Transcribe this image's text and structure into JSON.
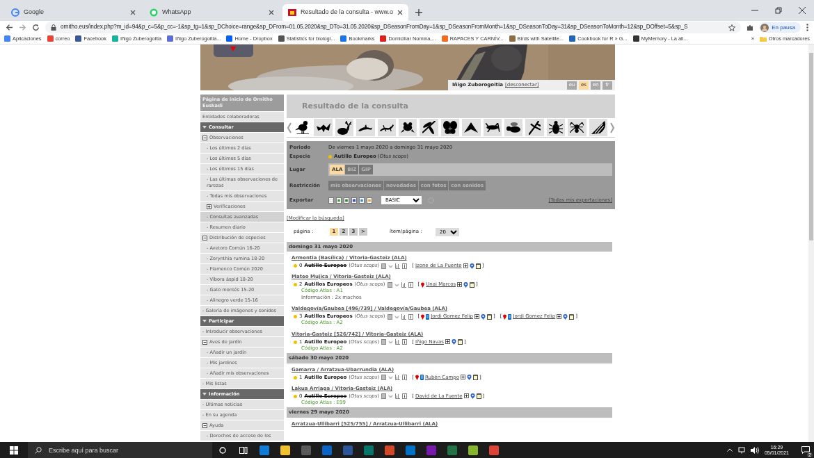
{
  "browser": {
    "tabs": [
      {
        "title": "Google",
        "selected": false,
        "kind": "google"
      },
      {
        "title": "WhatsApp",
        "selected": false,
        "kind": "whatsapp"
      },
      {
        "title": "Resultado de la consulta - www.o",
        "selected": true,
        "kind": "site"
      }
    ],
    "url": "ornitho.eus/index.php?m_id=94&p_c=5&p_cc=-1&sp_tg=1&sp_DChoice=range&sp_DFrom=01.05.2020&sp_DTo=31.05.2020&sp_DSeasonFromDay=1&sp_DSeasonFromMonth=1&sp_DSeasonToDay=31&sp_DSeasonToMonth=12&sp_DOffset=5&sp_S",
    "profile": "En pausa",
    "bookmarks": [
      {
        "label": "Aplicaciones",
        "color": "#4285f4"
      },
      {
        "label": "correo",
        "color": "#ea4335"
      },
      {
        "label": "Facebook",
        "color": "#3b5998"
      },
      {
        "label": "Iñigo Zuberogoitia",
        "color": "#18b39b"
      },
      {
        "label": "Iñigo Zuberogoitia...",
        "color": "#5b6fd6"
      },
      {
        "label": "Home - Dropbox",
        "color": "#0061fe"
      },
      {
        "label": "Statistics for biologi...",
        "color": "#555555"
      },
      {
        "label": "Bookmarks",
        "color": "#1a73e8"
      },
      {
        "label": "Domiciliar Nomina,...",
        "color": "#e0201b"
      },
      {
        "label": "RAPACES Y CARNÍV...",
        "color": "#f36d21"
      },
      {
        "label": "Birds with Satellite...",
        "color": "#8d6e48"
      },
      {
        "label": "Cookbook for R » G...",
        "color": "#2165b6"
      },
      {
        "label": "MyMemory - La ali...",
        "color": "#333333"
      }
    ],
    "bookmarks_overflow": "»",
    "other_bookmarks": "Otros marcadores"
  },
  "header": {
    "user": "Iñigo Zuberogoitia",
    "logout": "[desconectar]",
    "languages": [
      {
        "code": "eu",
        "selected": false
      },
      {
        "code": "es",
        "selected": true
      },
      {
        "code": "en",
        "selected": false
      },
      {
        "code": "fr",
        "selected": false
      }
    ]
  },
  "sidebar": [
    {
      "kind": "home",
      "text": "Página de inicio de Ornitho Euskadi",
      "selected": false
    },
    {
      "kind": "link",
      "text": "Entidades colaboradoras",
      "selected": false
    },
    {
      "kind": "header",
      "text": "Consultar",
      "expanded": true,
      "children": [
        {
          "kind": "group",
          "text": "Observaciones",
          "expanded": true,
          "children": [
            {
              "kind": "link",
              "text": "- Los últimos 2 días",
              "selected": false
            },
            {
              "kind": "link",
              "text": "- Los últimos 5 días",
              "selected": false
            },
            {
              "kind": "link",
              "text": "- Los últimos 15 días",
              "selected": false
            },
            {
              "kind": "link",
              "text": "- Las últimas observaciones de rarezas",
              "selected": false
            },
            {
              "kind": "link",
              "text": "- Todas mis observaciones",
              "selected": false
            },
            {
              "kind": "group",
              "text": "Verificaciones",
              "expanded": false
            },
            {
              "kind": "link",
              "text": "- Consultas avanzadas",
              "selected": true
            },
            {
              "kind": "link",
              "text": "- Resumen diario",
              "selected": false
            }
          ]
        },
        {
          "kind": "group",
          "text": "Distribución de especies",
          "expanded": true,
          "children": [
            {
              "kind": "link",
              "text": "- Avetoro Común 16-20",
              "selected": false
            },
            {
              "kind": "link",
              "text": "- Zerynthia rumina 18-20",
              "selected": false
            },
            {
              "kind": "link",
              "text": "- Flamenco Común 2020",
              "selected": false
            },
            {
              "kind": "link",
              "text": "- Víbora áspid 18-20",
              "selected": false
            },
            {
              "kind": "link",
              "text": "- Gato montés 15-20",
              "selected": false
            },
            {
              "kind": "link",
              "text": "- Alinegro verde 15-16",
              "selected": false
            }
          ]
        },
        {
          "kind": "link",
          "text": "- Galería de imágenes y sonidos",
          "selected": false
        }
      ]
    },
    {
      "kind": "header",
      "text": "Participar",
      "expanded": true,
      "children": [
        {
          "kind": "link",
          "text": "- Introducir observaciones",
          "selected": false
        },
        {
          "kind": "group",
          "text": "Aves de jardín",
          "expanded": true,
          "children": [
            {
              "kind": "link",
              "text": "- Añadir un jardín",
              "selected": false
            },
            {
              "kind": "link",
              "text": "- Mis jardines",
              "selected": false
            },
            {
              "kind": "link",
              "text": "- Añadir mis observaciones",
              "selected": false
            }
          ]
        },
        {
          "kind": "link",
          "text": "- Mis listas",
          "selected": false
        }
      ]
    },
    {
      "kind": "header",
      "text": "Información",
      "expanded": true,
      "children": [
        {
          "kind": "link",
          "text": "- Últimas noticias",
          "selected": false
        },
        {
          "kind": "link",
          "text": "- En su agenda",
          "selected": false
        },
        {
          "kind": "group",
          "text": "Ayuda",
          "expanded": true,
          "children": [
            {
              "kind": "link",
              "text": "- Derechos de acceso de los",
              "selected": false
            }
          ]
        }
      ]
    }
  ],
  "title": "Resultado de la consulta",
  "taxa": [
    {
      "kind": "bird",
      "selected": true
    },
    {
      "kind": "bat",
      "selected": false
    },
    {
      "kind": "deer",
      "selected": false
    },
    {
      "kind": "dolphin",
      "selected": false
    },
    {
      "kind": "lizard",
      "selected": false
    },
    {
      "kind": "frog",
      "selected": false
    },
    {
      "kind": "dragonfly",
      "selected": false
    },
    {
      "kind": "butterfly",
      "selected": false
    },
    {
      "kind": "moth",
      "selected": false
    },
    {
      "kind": "grasshopper",
      "selected": false
    },
    {
      "kind": "bee",
      "selected": false
    },
    {
      "kind": "mantis",
      "selected": false
    },
    {
      "kind": "beetle",
      "selected": false
    },
    {
      "kind": "spider",
      "selected": false
    },
    {
      "kind": "shell",
      "selected": false
    }
  ],
  "filters": {
    "period_label": "Periodo",
    "period": "De viernes 1 mayo 2020 a domingo 31 mayo 2020",
    "species_label": "Especie",
    "species": "**Autillo Europeo** (*Otus scops*)",
    "place_label": "Lugar",
    "places": [
      {
        "label": "ALA",
        "selected": true
      },
      {
        "label": "BIZ",
        "selected": false
      },
      {
        "label": "GIP",
        "selected": false
      }
    ],
    "restriction_label": "Restricción",
    "restrictions": [
      {
        "label": "mis observaciones",
        "selected": false
      },
      {
        "label": "novedades",
        "selected": false
      },
      {
        "label": "con fotos",
        "selected": false
      },
      {
        "label": "con sonidos",
        "selected": false
      }
    ],
    "export_label": "Exportar",
    "export_format": "BASIC",
    "all_exports": "[Todas mis exportaciones]"
  },
  "modify": "[Modificar la búsqueda]",
  "pager": {
    "label": "página :",
    "pages": [
      {
        "label": "1",
        "selected": true
      },
      {
        "label": "2",
        "selected": false
      },
      {
        "label": "3",
        "selected": false
      },
      {
        "label": ">",
        "selected": false
      }
    ],
    "per_page_label": "ítem/página :",
    "per_page": "20"
  },
  "days": [
    {
      "date": "domingo 31 mayo 2020",
      "entries": [
        {
          "location": "Armentia (Basílica) / Vitoria-Gasteiz (ALA)",
          "count": "0",
          "species": "Autillo Europeo",
          "crossed": true,
          "scientific": "(*Otus scops*)",
          "observers": [
            {
              "open": "[",
              "name": "Izone de La Puente",
              "close": "]",
              "pin": false,
              "phone": false
            }
          ]
        },
        {
          "location": "Mateo Mujica / Vitoria-Gasteiz (ALA)",
          "count": "2",
          "species": "Autillos Europeos",
          "crossed": false,
          "scientific": "(*Otus scops*)",
          "observers": [
            {
              "open": "[",
              "name": "Unai Marcos",
              "close": "]",
              "pin": true,
              "phone": false
            }
          ],
          "details": [
            {
              "kind": "atlas",
              "text": "Código Atlas : A1"
            },
            {
              "kind": "info",
              "text": "Información : 2x machos"
            }
          ]
        },
        {
          "location": "Valdegovía/Gaubea [496/739] / Valdegovía/Gaubea (ALA)",
          "count": "3",
          "species": "Autillos Europeos",
          "crossed": false,
          "scientific": "(*Otus scops*)",
          "observers": [
            {
              "open": "[",
              "name": "Jordi Gomez Felip",
              "close": "]",
              "pin": true,
              "phone": true
            },
            {
              "open": "[",
              "name": "Jordi Gomez Felip",
              "close": "]",
              "pin": true,
              "phone": true
            }
          ],
          "details": [
            {
              "kind": "atlas",
              "text": "Código Atlas : A2"
            }
          ]
        },
        {
          "location": "Vitoria-Gasteiz [526/742] / Vitoria-Gasteiz (ALA)",
          "count": "1",
          "species": "Autillo Europeo",
          "crossed": false,
          "scientific": "(*Otus scops*)",
          "observers": [
            {
              "open": "[",
              "name": "Iñigo Navas",
              "close": "]",
              "pin": false,
              "phone": false
            }
          ],
          "details": [
            {
              "kind": "atlas",
              "text": "Código Atlas : A2"
            }
          ]
        }
      ]
    },
    {
      "date": "sábado 30 mayo 2020",
      "entries": [
        {
          "location": "Gamarra / Arratzua-Ubarrundia (ALA)",
          "count": "1",
          "species": "Autillo Europeo",
          "crossed": false,
          "scientific": "(*Otus scops*)",
          "observers": [
            {
              "open": "[",
              "name": "Rubén Campo",
              "close": "]",
              "pin": true,
              "phone": true
            }
          ]
        },
        {
          "location": "Lakua Arriaga / Vitoria-Gasteiz (ALA)",
          "count": "0",
          "species": "Autillo Europeo",
          "crossed": true,
          "scientific": "(*Otus scops*)",
          "observers": [
            {
              "open": "[",
              "name": "David de La Fuente",
              "close": "]",
              "pin": false,
              "phone": false
            }
          ],
          "details": [
            {
              "kind": "atlas",
              "text": "Código Atlas : E99"
            }
          ]
        }
      ]
    },
    {
      "date": "viernes 29 mayo 2020",
      "entries": [
        {
          "location": "Arratzua-Ullibarri [525/755] / Arratzua-Ullibarri (ALA)"
        }
      ]
    }
  ],
  "taskbar": {
    "search_placeholder": "Escribe aquí para buscar",
    "apps": [
      {
        "color": "#0f7bd6"
      },
      {
        "color": "#f2c12e"
      },
      {
        "color": "#5a5a5a"
      },
      {
        "color": "#0a64c8"
      },
      {
        "color": "#2b579a"
      },
      {
        "color": "#077568"
      },
      {
        "color": "#d24726"
      },
      {
        "color": "#0072c6"
      },
      {
        "color": "#7719aa"
      },
      {
        "color": "#217346"
      },
      {
        "color": "#84b52c"
      },
      {
        "color": "#db4437"
      }
    ],
    "time": "16:29",
    "date": "05/01/2021",
    "notifications": "2"
  }
}
